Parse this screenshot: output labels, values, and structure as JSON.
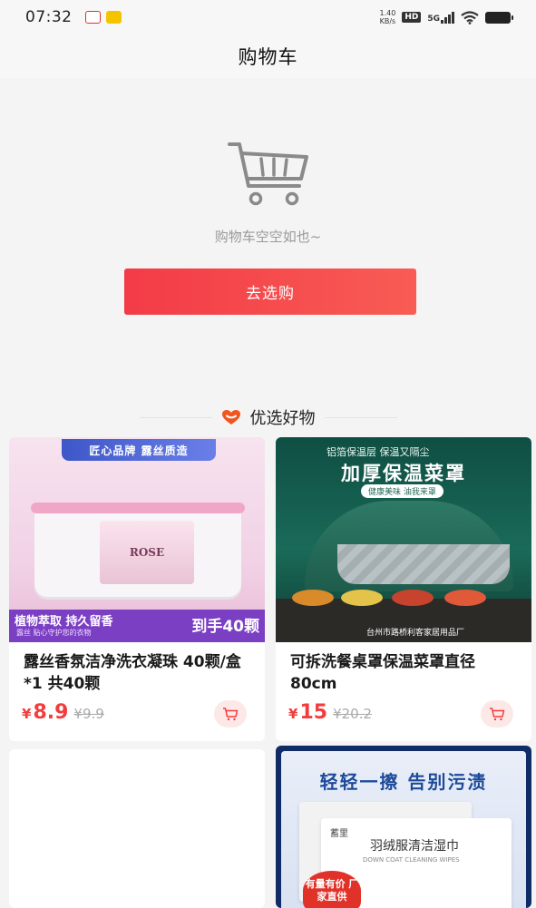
{
  "status_bar": {
    "time": "07:32",
    "speed_value": "1.40",
    "speed_unit": "KB/s",
    "hd": "HD",
    "network": "5G"
  },
  "header": {
    "title": "购物车"
  },
  "empty_state": {
    "message": "购物车空空如也~",
    "button_label": "去选购"
  },
  "recommend": {
    "title": "优选好物",
    "products": [
      {
        "name": "露丝香氛洁净洗衣凝珠 40颗/盒*1 共40颗",
        "price_symbol": "¥",
        "price": "8.9",
        "original_price": "¥9.9",
        "banner": "匠心品牌 露丝质造",
        "brand": "ROSE",
        "promo_left": "植物萃取 持久留香",
        "promo_sub": "露丝 贴心守护您的衣物",
        "promo_right": "到手40颗"
      },
      {
        "name": "可拆洗餐桌罩保温菜罩直径80cm",
        "price_symbol": "¥",
        "price": "15",
        "original_price": "¥20.2",
        "banner_top": "铝箔保温层 保温又隔尘",
        "banner_title": "加厚保温菜罩",
        "banner_pill": "健康美味 油我来罩",
        "banner_foot": "台州市路桥利客家居用品厂"
      },
      {
        "name": "",
        "price_symbol": "",
        "price": "",
        "original_price": ""
      },
      {
        "headline": "轻轻一擦 告别污渍",
        "pack_logo": "蓄里",
        "pack_title": "羽绒服清洁湿巾",
        "pack_subtitle": "DOWN COAT CLEANING WIPES",
        "badge": "有量有价 厂家直供"
      }
    ]
  }
}
